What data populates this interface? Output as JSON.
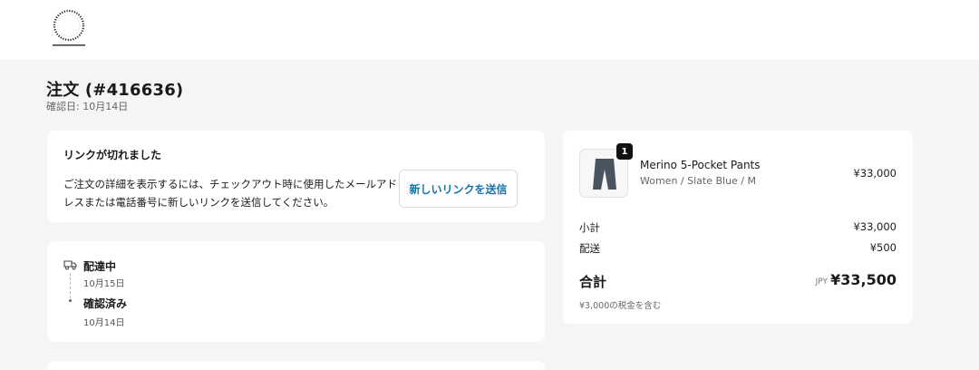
{
  "brand": {
    "logo_text": "yamatomichi"
  },
  "order": {
    "title": "注文 (#416636)",
    "confirmed_date": "確認日: 10月14日"
  },
  "expired_link": {
    "heading": "リンクが切れました",
    "message": "ご注文の詳細を表示するには、チェックアウト時に使用したメールアドレスまたは電話番号に新しいリンクを送信してください。",
    "button_label": "新しいリンクを送信"
  },
  "timeline": [
    {
      "status": "配達中",
      "date": "10月15日"
    },
    {
      "status": "確認済み",
      "date": "10月14日"
    }
  ],
  "summary": {
    "item": {
      "quantity": "1",
      "name": "Merino 5-Pocket Pants",
      "variant": "Women / Slate Blue / M",
      "price": "¥33,000"
    },
    "subtotal_label": "小計",
    "subtotal_value": "¥33,000",
    "shipping_label": "配送",
    "shipping_value": "¥500",
    "total_label": "合計",
    "currency": "JPY",
    "total_value": "¥33,500",
    "tax_note": "¥3,000の税金を含む"
  },
  "colors": {
    "link": "#1772a8",
    "background": "#f5f5f5"
  }
}
